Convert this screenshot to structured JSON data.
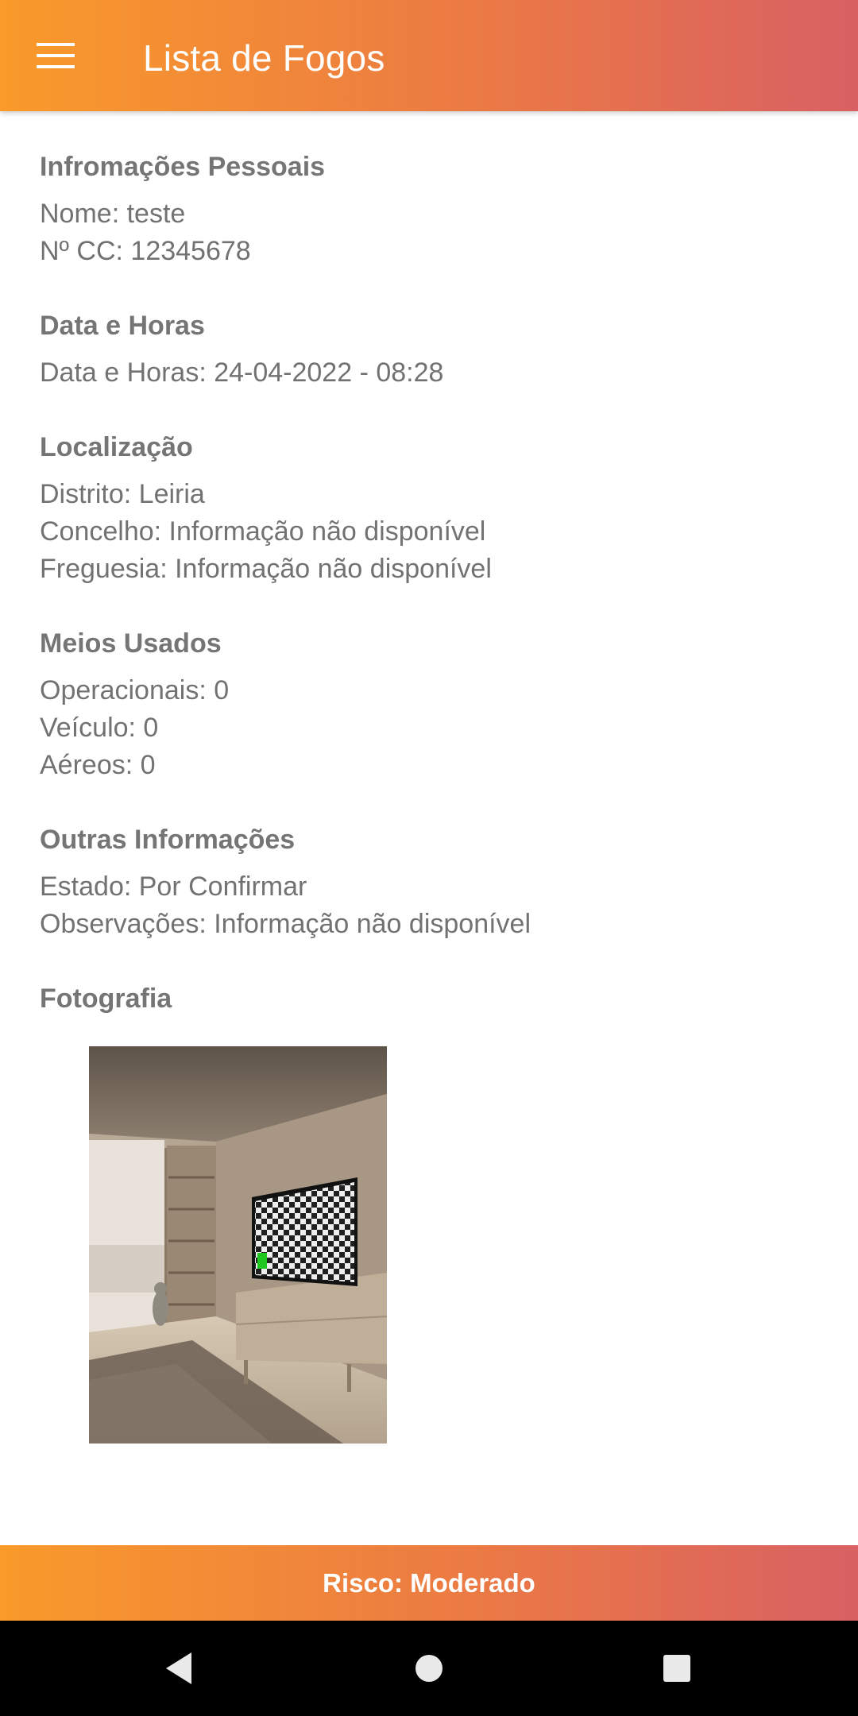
{
  "appbar": {
    "title": "Lista de Fogos",
    "menu_icon": "hamburger-menu-icon"
  },
  "sections": {
    "personal": {
      "title": "Infromações Pessoais",
      "lines": [
        "Nome: teste",
        "Nº CC: 12345678"
      ]
    },
    "datetime": {
      "title": "Data e Horas",
      "lines": [
        "Data e Horas: 24-04-2022 - 08:28"
      ]
    },
    "location": {
      "title": "Localização",
      "lines": [
        "Distrito: Leiria",
        "Concelho: Informação não disponível",
        "Freguesia: Informação não disponível"
      ]
    },
    "means": {
      "title": "Meios Usados",
      "lines": [
        "Operacionais: 0",
        "Veículo: 0",
        "Aéreos: 0"
      ]
    },
    "other": {
      "title": "Outras Informações",
      "lines": [
        "Estado: Por Confirmar",
        "Observações: Informação não disponível"
      ]
    },
    "photo": {
      "title": "Fotografia"
    }
  },
  "bottom_bar": {
    "label": "Risco: Moderado"
  },
  "navbar": {
    "back_icon": "back-triangle-icon",
    "home_icon": "home-circle-icon",
    "recents_icon": "recents-square-icon"
  },
  "colors": {
    "gradient_start": "#f99a2a",
    "gradient_end": "#d96063",
    "text": "#727272"
  }
}
